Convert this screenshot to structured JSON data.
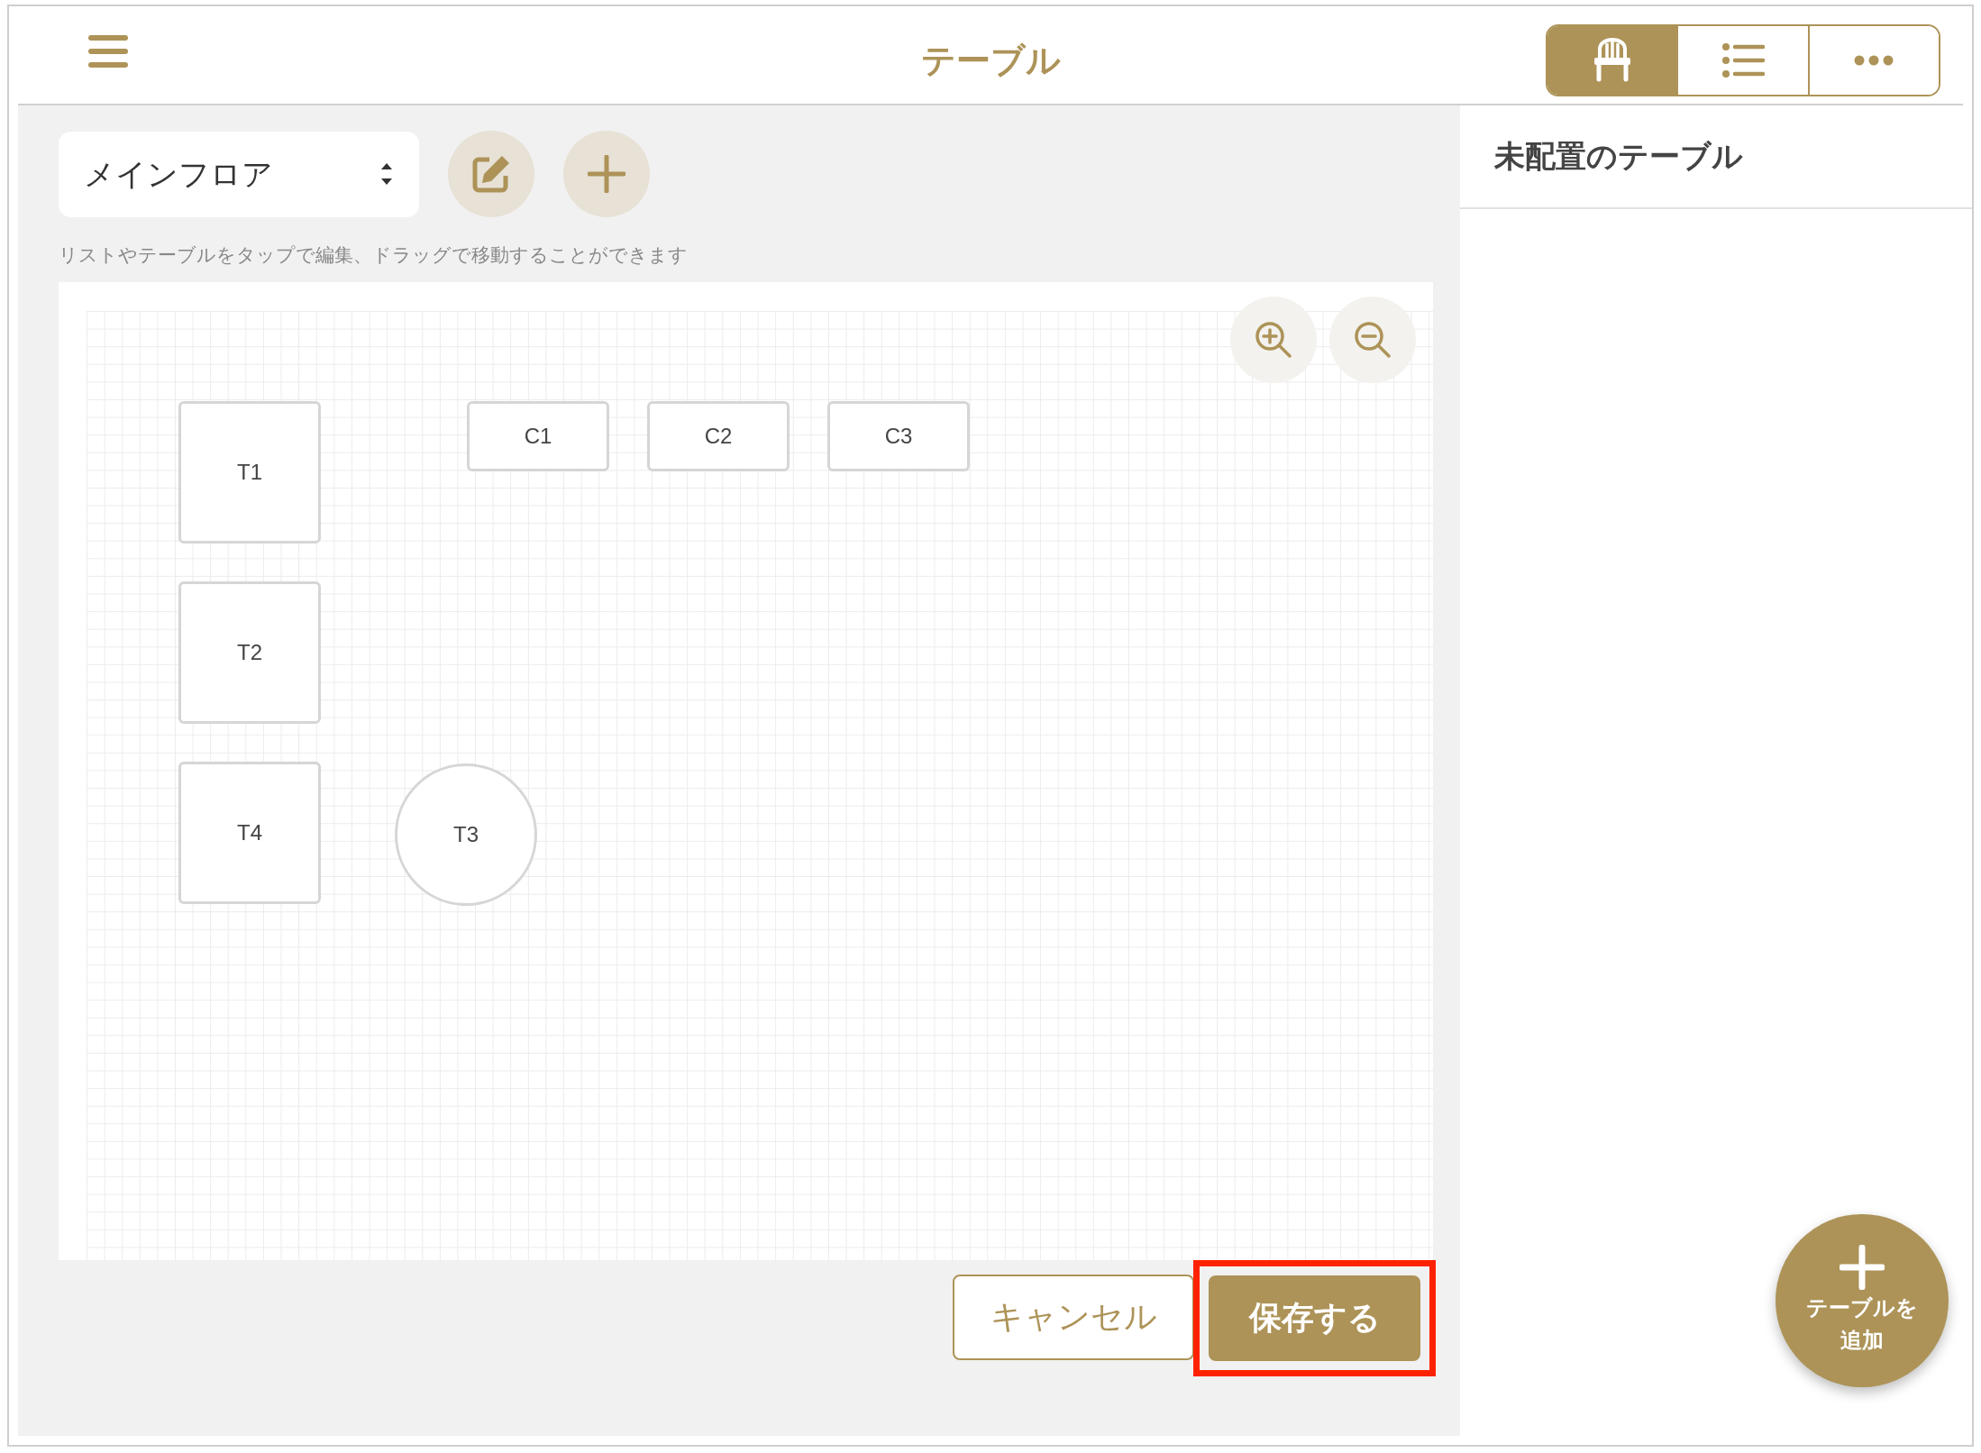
{
  "header": {
    "title": "テーブル"
  },
  "view_tabs": [
    {
      "kind": "chair",
      "selected": true
    },
    {
      "kind": "list",
      "selected": false
    },
    {
      "kind": "more",
      "selected": false
    }
  ],
  "floor_select": {
    "value": "メインフロア"
  },
  "hint": "リストやテーブルをタップで編集、ドラッグで移動することができます",
  "tables": [
    {
      "label": "T1",
      "kind": "square"
    },
    {
      "label": "C1",
      "kind": "rect"
    },
    {
      "label": "C2",
      "kind": "rect"
    },
    {
      "label": "C3",
      "kind": "rect"
    },
    {
      "label": "T2",
      "kind": "square"
    },
    {
      "label": "T4",
      "kind": "square"
    },
    {
      "label": "T3",
      "kind": "round"
    }
  ],
  "buttons": {
    "cancel": "キャンセル",
    "save": "保存する"
  },
  "unplaced_panel": {
    "title": "未配置のテーブル"
  },
  "fab": {
    "label": "テーブルを追加"
  }
}
